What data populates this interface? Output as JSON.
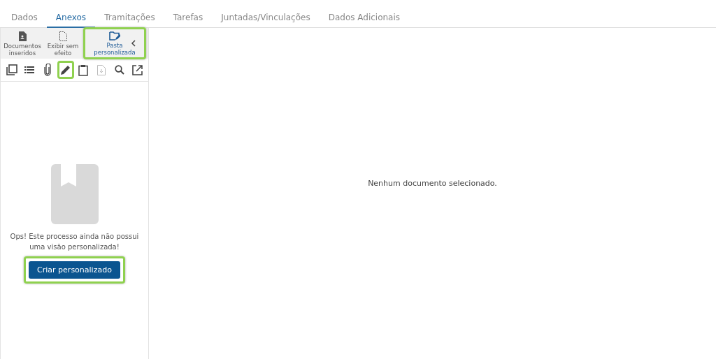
{
  "tabs": [
    {
      "label": "Dados",
      "selected": false
    },
    {
      "label": "Anexos",
      "selected": true
    },
    {
      "label": "Tramitações",
      "selected": false
    },
    {
      "label": "Tarefas",
      "selected": false
    },
    {
      "label": "Juntadas/Vinculações",
      "selected": false
    },
    {
      "label": "Dados Adicionais",
      "selected": false
    }
  ],
  "views": [
    {
      "kind": "document",
      "label": "Documentos inseridos",
      "selected": false,
      "highlighted": false
    },
    {
      "kind": "dashed",
      "label": "Exibir sem efeito",
      "selected": false,
      "highlighted": false
    },
    {
      "kind": "folder",
      "label": "Pasta personalizada",
      "selected": true,
      "highlighted": true
    }
  ],
  "tools": [
    {
      "kind": "copy",
      "disabled": false,
      "highlighted": false
    },
    {
      "kind": "list",
      "disabled": false,
      "highlighted": false
    },
    {
      "kind": "clip",
      "disabled": false,
      "highlighted": false
    },
    {
      "kind": "pencil",
      "disabled": false,
      "highlighted": true
    },
    {
      "kind": "clipboard",
      "disabled": false,
      "highlighted": false
    },
    {
      "kind": "filedown",
      "disabled": true,
      "highlighted": false
    },
    {
      "kind": "search",
      "disabled": false,
      "highlighted": false
    },
    {
      "kind": "external",
      "disabled": false,
      "highlighted": false
    }
  ],
  "empty": {
    "message": "Ops! Este processo ainda não possui uma visão personalizada!",
    "button": {
      "label": "Criar personalizado",
      "highlighted": true
    }
  },
  "main": {
    "message": "Nenhum documento selecionado."
  }
}
